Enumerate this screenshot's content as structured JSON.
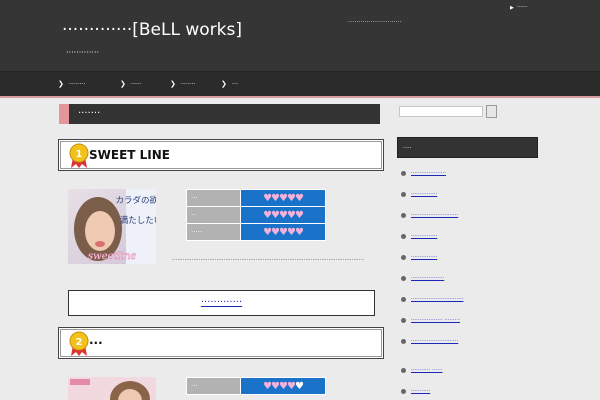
{
  "header": {
    "site_title": "·············[BeLL works]",
    "site_description": "·············",
    "tagline": "··························",
    "top_link": "·····"
  },
  "nav": {
    "items": [
      "········",
      "·····",
      "·······",
      "···"
    ]
  },
  "main": {
    "section_title": "·······",
    "ranks": [
      {
        "rank": "1",
        "name": "SWEET LINE",
        "thumb_caption_1": "カラダの欲求",
        "thumb_caption_2": "満たしたい",
        "thumb_logo": "sweetline",
        "ratings": [
          {
            "label": "···",
            "value": "♥♥♥♥♥"
          },
          {
            "label": "··",
            "value": "♥♥♥♥♥"
          },
          {
            "label": "·····",
            "value": "♥♥♥♥♥"
          }
        ],
        "description": "············································································································",
        "cta_label": "·············"
      },
      {
        "rank": "2",
        "name": "···",
        "ratings": [
          {
            "label": "···",
            "value": "♥♥♥♥",
            "empty": "♥"
          }
        ]
      }
    ]
  },
  "sidebar": {
    "search_placeholder": "",
    "heading": "····",
    "links": [
      "····················",
      "···············",
      "···························",
      "···············",
      "···············",
      "···················",
      "······························",
      "·················· ·········",
      "···························",
      "··········· ······",
      "···········"
    ]
  },
  "colors": {
    "header_bg": "#353535",
    "nav_bg": "#2b2b2b",
    "accent_pink": "#e3979b",
    "rating_blue": "#1a73c9",
    "rating_heart": "#f3b2dc",
    "link_blue": "#1a27b8",
    "page_bg": "#ebebeb"
  }
}
